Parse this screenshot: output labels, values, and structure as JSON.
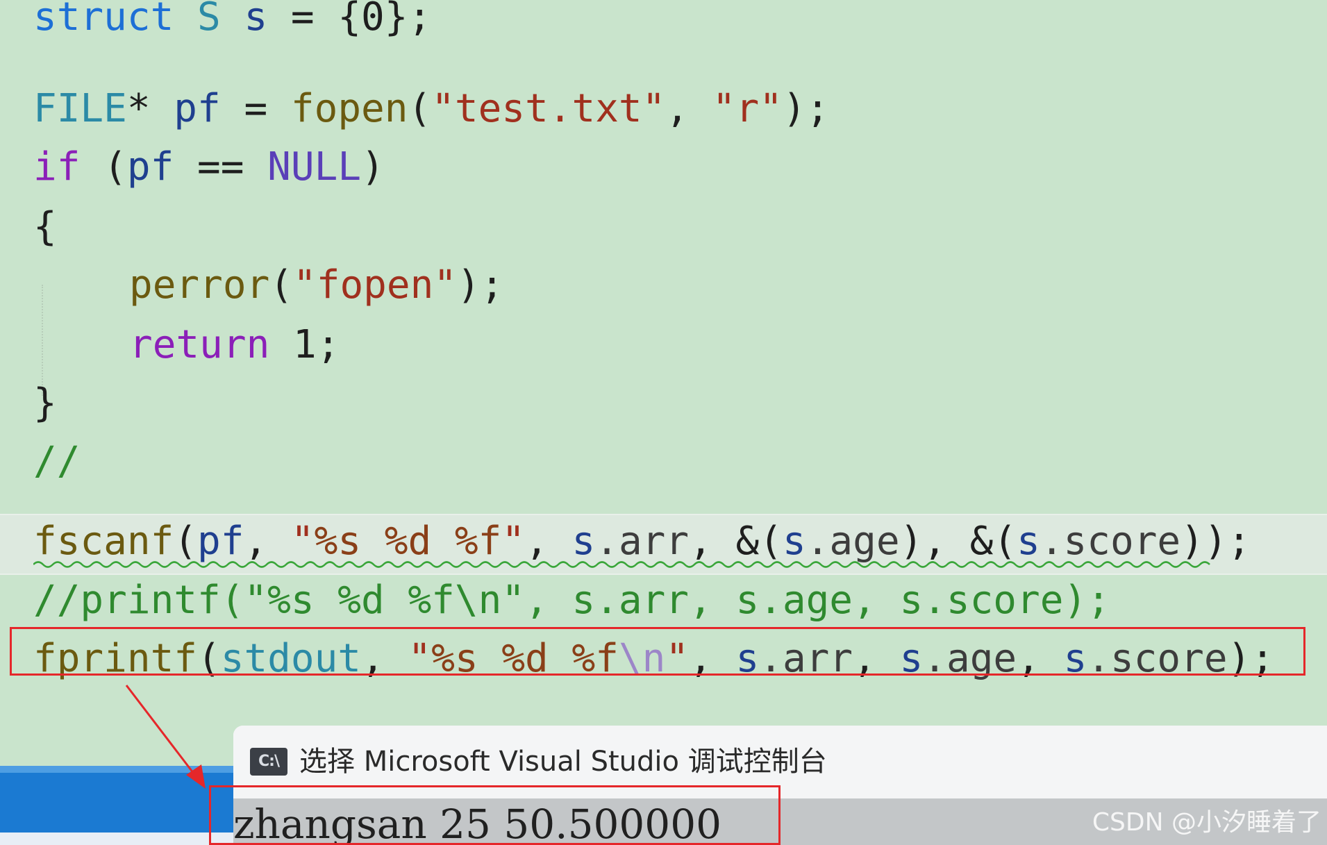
{
  "code": {
    "line1": {
      "kw": "struct",
      "type": "S",
      "var": "s",
      "rest": " = {0};"
    },
    "line3": {
      "type": "FILE",
      "p1": "* ",
      "var": "pf",
      "p2": " = ",
      "fn": "fopen",
      "p3": "(",
      "s1": "\"test.txt\"",
      "p4": ", ",
      "s2": "\"r\"",
      "p5": ");"
    },
    "line4": {
      "kw": "if",
      "p1": " (",
      "var": "pf",
      "p2": " == ",
      "macro": "NULL",
      "p3": ")"
    },
    "line5": "{",
    "line6": {
      "fn": "perror",
      "p1": "(",
      "s1": "\"fopen\"",
      "p2": ");"
    },
    "line7": {
      "kw": "return",
      "rest": " 1;"
    },
    "line8": "}",
    "line9": "//",
    "line10": {
      "fn": "fscanf",
      "p1": "(",
      "var": "pf",
      "p2": ", ",
      "s1a": "\"",
      "f1": "%s",
      "s1b": " ",
      "f2": "%d",
      "s1c": " ",
      "f3": "%f",
      "s1d": "\"",
      "p3": ", ",
      "v2": "s",
      "m2": ".arr",
      "p4": ", &(",
      "v3": "s",
      "m3": ".age",
      "p5": "), &(",
      "v4": "s",
      "m4": ".score",
      "p6": "));"
    },
    "line11": "//printf(\"%s %d %f\\n\", s.arr, s.age, s.score);",
    "line12": {
      "fn": "fprintf",
      "p1": "(",
      "var": "stdout",
      "p2": ", ",
      "s1a": "\"",
      "f1": "%s",
      "s1b": " ",
      "f2": "%d",
      "s1c": " ",
      "f3": "%f",
      "esc": "\\n",
      "s1d": "\"",
      "p3": ", ",
      "v2": "s",
      "m2": ".arr",
      "p4": ", ",
      "v3": "s",
      "m3": ".age",
      "p5": ", ",
      "v4": "s",
      "m4": ".score",
      "p6": ");"
    }
  },
  "console": {
    "icon_label": "C:\\",
    "title": "选择 Microsoft Visual Studio 调试控制台",
    "output": "zhangsan 25 50.500000"
  },
  "watermark": "CSDN @小汐睡着了",
  "colors": {
    "editor_bg": "#c9e4cc",
    "highlight_border": "#e5272a",
    "keyword": "#1d6fd6",
    "control": "#8b1fb8",
    "string": "#a0301e",
    "comment": "#2f8a2f"
  }
}
